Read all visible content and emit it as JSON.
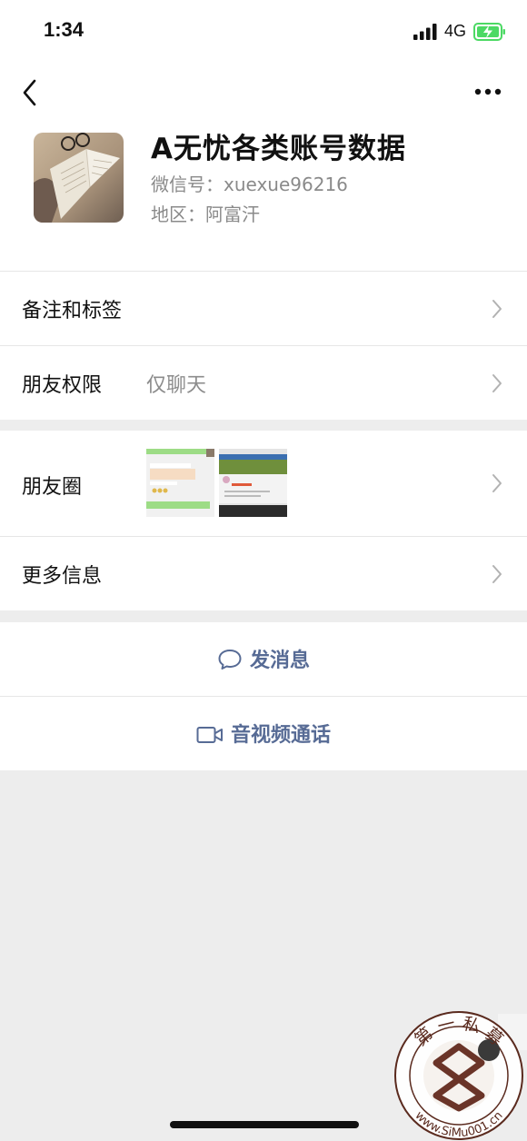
{
  "status_bar": {
    "time": "1:34",
    "network": "4G"
  },
  "profile": {
    "name": "A无忧各类账号数据",
    "wechat_id": "微信号：xuexue96216",
    "region": "地区：阿富汗"
  },
  "rows": {
    "remarks_tags": "备注和标签",
    "friend_permissions": {
      "label": "朋友权限",
      "value": "仅聊天"
    },
    "moments": "朋友圈",
    "more_info": "更多信息"
  },
  "actions": {
    "send_message": "发消息",
    "video_call": "音视频通话"
  },
  "watermark": {
    "top_text": "第 一 私 募",
    "url": "www.SiMu001.cn"
  },
  "colors": {
    "link": "#576b95",
    "battery": "#4cd964",
    "background": "#ededed"
  },
  "icons": [
    "back-arrow-icon",
    "more-dots-icon",
    "chevron-right-icon",
    "chat-bubble-icon",
    "video-camera-icon"
  ]
}
